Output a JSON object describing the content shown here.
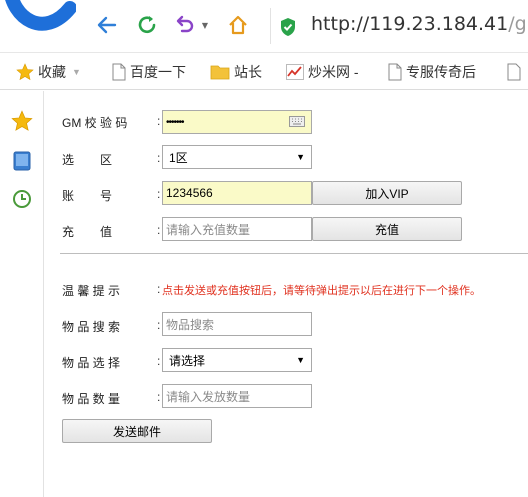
{
  "browser": {
    "url_host": "http://119.23.184.41",
    "url_path": "/gm/"
  },
  "bookmarks": [
    {
      "label": "收藏",
      "icon": "star-icon"
    },
    {
      "label": "百度一下",
      "icon": "page-icon"
    },
    {
      "label": "站长",
      "icon": "folder-icon"
    },
    {
      "label": "炒米网 -",
      "icon": "chart-icon"
    },
    {
      "label": "专服传奇后",
      "icon": "page-icon"
    }
  ],
  "sidebar": [
    "star-icon",
    "tablet-icon",
    "clock-icon"
  ],
  "form": {
    "gm_code": {
      "label": "GM 校 验 码",
      "value": "•••••••"
    },
    "server": {
      "label": [
        "选",
        "区"
      ],
      "value": "1区"
    },
    "account": {
      "label": [
        "账",
        "号"
      ],
      "value": "1234566",
      "button": "加入VIP"
    },
    "recharge": {
      "label": [
        "充",
        "值"
      ],
      "placeholder": "请输入充值数量",
      "button": "充值"
    },
    "tip": {
      "label": "温 馨 提 示",
      "text": "点击发送或充值按钮后，请等待弹出提示以后在进行下一个操作。"
    },
    "item_search": {
      "label": "物 品 搜 索",
      "placeholder": "物品搜索"
    },
    "item_select": {
      "label": "物 品 选 择",
      "value": "请选择"
    },
    "item_qty": {
      "label": "物 品 数 量",
      "placeholder": "请输入发放数量"
    },
    "send_button": "发送邮件"
  },
  "colors": {
    "accent_blue": "#2f7fd8",
    "autofill_yellow": "#fafac8",
    "notice_red": "#e0301e",
    "refresh_green": "#2aa34a",
    "undo_purple": "#8a44c8",
    "home_orange": "#e69a1d"
  }
}
